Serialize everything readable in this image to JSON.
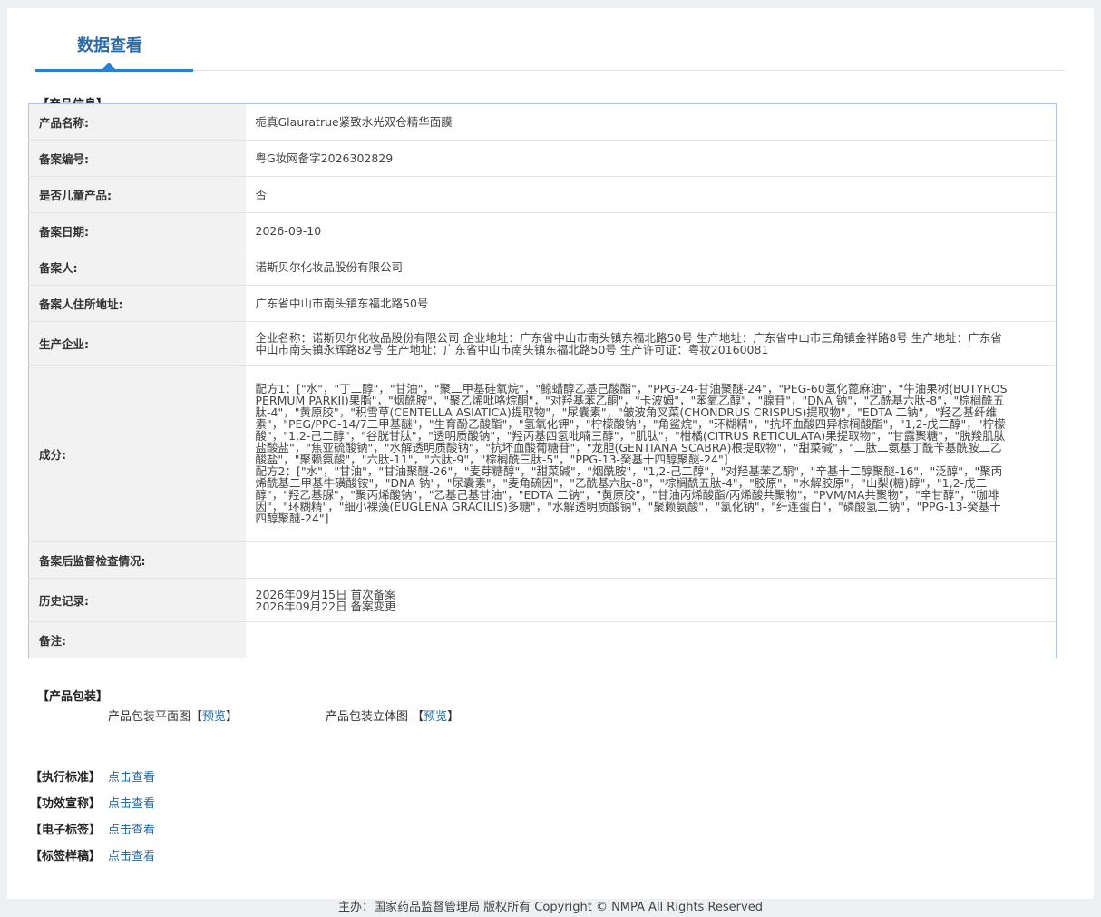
{
  "tab": {
    "title": "数据查看"
  },
  "sections": {
    "product_info": "【产品信息】",
    "packaging": "【产品包装】"
  },
  "rows": [
    {
      "label": "产品名称:",
      "value": "栀真Glauratrue紧致水光双仓精华面膜"
    },
    {
      "label": "备案编号:",
      "value": "粤G妆网备字2026302829"
    },
    {
      "label": "是否儿童产品:",
      "value": "否"
    },
    {
      "label": "备案日期:",
      "value": "2026-09-10"
    },
    {
      "label": "备案人:",
      "value": "诺斯贝尔化妆品股份有限公司"
    },
    {
      "label": "备案人住所地址:",
      "value": "广东省中山市南头镇东福北路50号"
    },
    {
      "label": "生产企业:",
      "value": "企业名称：诺斯贝尔化妆品股份有限公司 企业地址：广东省中山市南头镇东福北路50号 生产地址：广东省中山市三角镇金祥路8号 生产地址：广东省中山市南头镇永辉路82号 生产地址：广东省中山市南头镇东福北路50号 生产许可证：粤妆20160081"
    },
    {
      "label": "成分:",
      "value": "配方1：[\"水\"，\"丁二醇\"，\"甘油\"，\"聚二甲基硅氧烷\"，\"鲸蜡醇乙基己酸酯\"，\"PPG-24-甘油聚醚-24\"，\"PEG-60氢化蓖麻油\"，\"牛油果树(BUTYROSPERMUM PARKII)果脂\"，\"烟酰胺\"，\"聚乙烯吡咯烷酮\"，\"对羟基苯乙酮\"，\"卡波姆\"，\"苯氧乙醇\"，\"腺苷\"，\"DNA 钠\"，\"乙酰基六肽-8\"，\"棕榈酰五肽-4\"，\"黄原胶\"，\"积雪草(CENTELLA ASIATICA)提取物\"，\"尿囊素\"，\"皱波角叉菜(CHONDRUS CRISPUS)提取物\"，\"EDTA 二钠\"，\"羟乙基纤维素\"，\"PEG/PPG-14/7二甲基醚\"，\"生育酚乙酸酯\"，\"氢氧化钾\"，\"柠檬酸钠\"，\"角鲨烷\"，\"环糊精\"，\"抗坏血酸四异棕榈酸酯\"，\"1,2-戊二醇\"，\"柠檬酸\"，\"1,2-己二醇\"，\"谷胱甘肽\"，\"透明质酸钠\"，\"羟丙基四氢吡喃三醇\"，\"肌肽\"，\"柑橘(CITRUS RETICULATA)果提取物\"，\"甘露聚糖\"，\"脱羧肌肽盐酸盐\"，\"焦亚硫酸钠\"，\"水解透明质酸钠\"，\"抗坏血酸葡糖苷\"，\"龙胆(GENTIANA SCABRA)根提取物\"，\"甜菜碱\"，\"二肽二氨基丁酰苄基酰胺二乙酸盐\"，\"聚赖氨酸\"，\"六肽-11\"，\"六肽-9\"，\"棕榈酰三肽-5\"，\"PPG-13-癸基十四醇聚醚-24\"]\n配方2：[\"水\"，\"甘油\"，\"甘油聚醚-26\"，\"麦芽糖醇\"，\"甜菜碱\"，\"烟酰胺\"，\"1,2-己二醇\"，\"对羟基苯乙酮\"，\"辛基十二醇聚醚-16\"，\"泛醇\"，\"聚丙烯酰基二甲基牛磺酸铵\"，\"DNA 钠\"，\"尿囊素\"，\"麦角硫因\"，\"乙酰基六肽-8\"，\"棕榈酰五肽-4\"，\"胶原\"，\"水解胶原\"，\"山梨(糖)醇\"，\"1,2-戊二醇\"，\"羟乙基脲\"，\"聚丙烯酸钠\"，\"乙基己基甘油\"，\"EDTA 二钠\"，\"黄原胶\"，\"甘油丙烯酸酯/丙烯酸共聚物\"，\"PVM/MA共聚物\"，\"辛甘醇\"，\"咖啡因\"，\"环糊精\"，\"细小裸藻(EUGLENA GRACILIS)多糖\"，\"水解透明质酸钠\"，\"聚赖氨酸\"，\"氯化钠\"，\"纤连蛋白\"，\"磷酸氢二钠\"，\"PPG-13-癸基十四醇聚醚-24\"]"
    },
    {
      "label": "备案后监督检查情况:",
      "value": ""
    },
    {
      "label": "历史记录:",
      "value": "2026年09月15日 首次备案\n2026年09月22日 备案变更"
    },
    {
      "label": "备注:",
      "value": ""
    }
  ],
  "packaging": {
    "flat_label": "产品包装平面图",
    "flat_link": "预览",
    "solid_label": "产品包装立体图",
    "solid_link": "预览"
  },
  "links": [
    {
      "label": "【执行标准】",
      "link": "点击查看"
    },
    {
      "label": "【功效宣称】",
      "link": "点击查看"
    },
    {
      "label": "【电子标签】",
      "link": "点击查看"
    },
    {
      "label": "【标签样稿】",
      "link": "点击查看"
    }
  ],
  "footer": "主办：国家药品监督管理局 版权所有 Copyright © NMPA All Rights Reserved"
}
